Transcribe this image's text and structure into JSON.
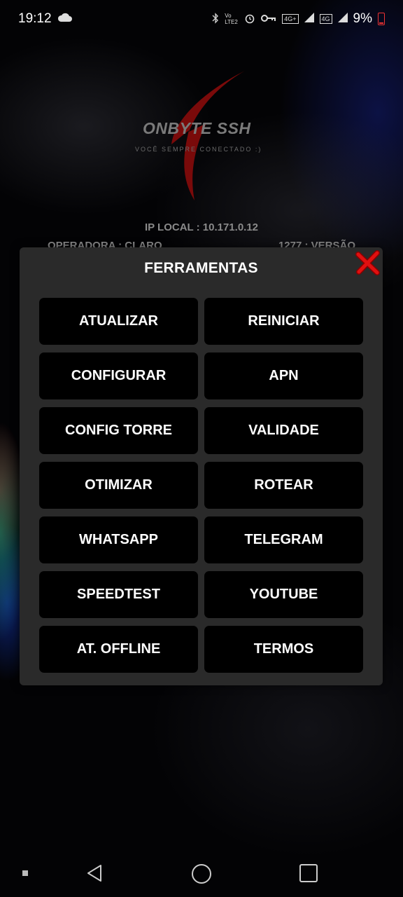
{
  "status_bar": {
    "time": "19:12",
    "battery": "9%",
    "icons": [
      "cloud-icon",
      "bluetooth-icon",
      "volte-icon",
      "alarm-icon",
      "vpn-key-icon",
      "signal-4g-plus-icon",
      "signal-4g-icon",
      "battery-icon"
    ],
    "volte_label": "Vo LTE2",
    "net1_label": "4G+",
    "net2_label": "4G"
  },
  "background": {
    "app_name": "ONBYTE SSH",
    "tagline": "VOCÊ SEMPRE CONECTADO :)",
    "ip_line": "IP LOCAL : 10.171.0.12",
    "operator_line": "OPERADORA : CLARO",
    "version_line": "1277 : VERSÃO"
  },
  "dialog": {
    "title": "FERRAMENTAS",
    "close_icon": "close-x-icon",
    "buttons": [
      "ATUALIZAR",
      "REINICIAR",
      "CONFIGURAR",
      "APN",
      "CONFIG TORRE",
      "VALIDADE",
      "OTIMIZAR",
      "ROTEAR",
      "WHATSAPP",
      "TELEGRAM",
      "SPEEDTEST",
      "YOUTUBE",
      "AT. OFFLINE",
      "TERMOS"
    ]
  },
  "nav_bar": {
    "icons": [
      "menu-dot-icon",
      "back-icon",
      "home-icon",
      "recents-icon"
    ]
  },
  "colors": {
    "dialog_bg": "#2a2a2a",
    "button_bg": "#000000",
    "close_red": "#e01010",
    "logo_red": "#7a0a0a"
  }
}
